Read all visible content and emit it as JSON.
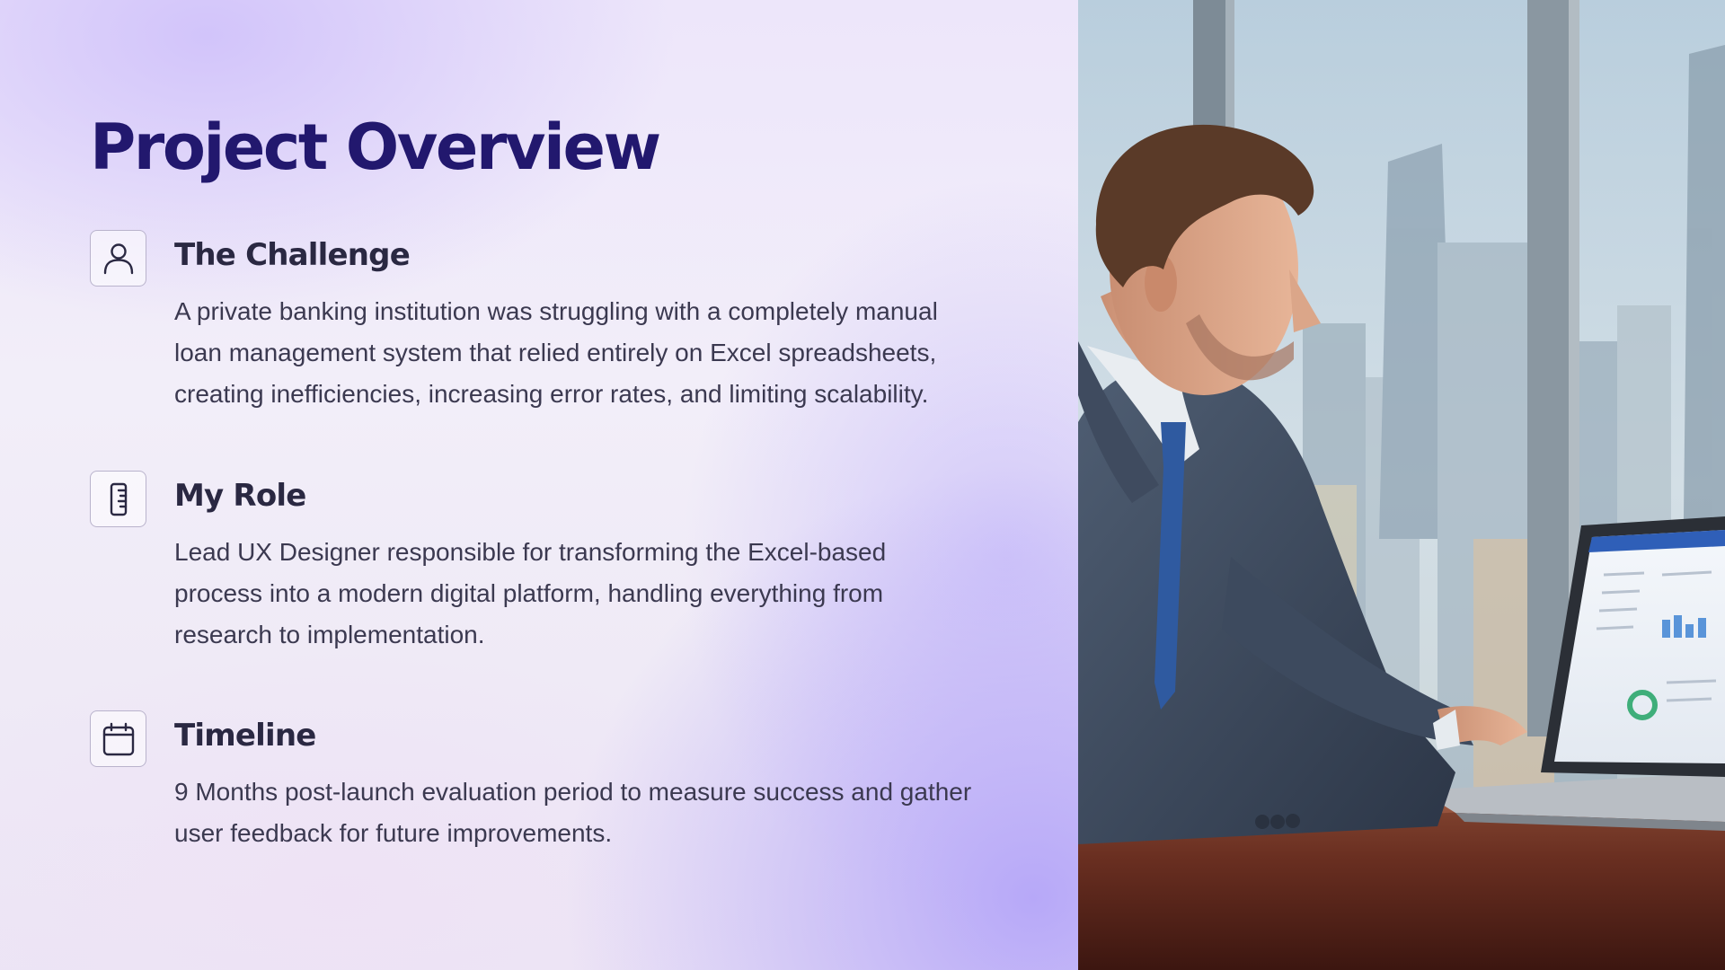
{
  "page": {
    "title": "Project Overview"
  },
  "sections": [
    {
      "heading": "The Challenge",
      "body": "A private banking institution was struggling with a completely manual loan management system that relied entirely on Excel spreadsheets, creating inefficiencies, increasing error rates, and limiting scalability.",
      "icon": "user-icon"
    },
    {
      "heading": "My Role",
      "body": "Lead UX Designer responsible for transforming the Excel-based process into a modern digital platform, handling everything from research to implementation.",
      "icon": "ruler-icon"
    },
    {
      "heading": "Timeline",
      "body": "9 Months post-launch evaluation period to measure success and gather user feedback for future improvements.",
      "icon": "calendar-icon"
    }
  ],
  "photo": {
    "subject": "businessman-using-laptop-photo"
  },
  "colors": {
    "title": "#22186e",
    "heading": "#2a2842",
    "body": "#3b3950",
    "icon_stroke": "#2a2842",
    "icon_border": "#b9b3cc"
  }
}
